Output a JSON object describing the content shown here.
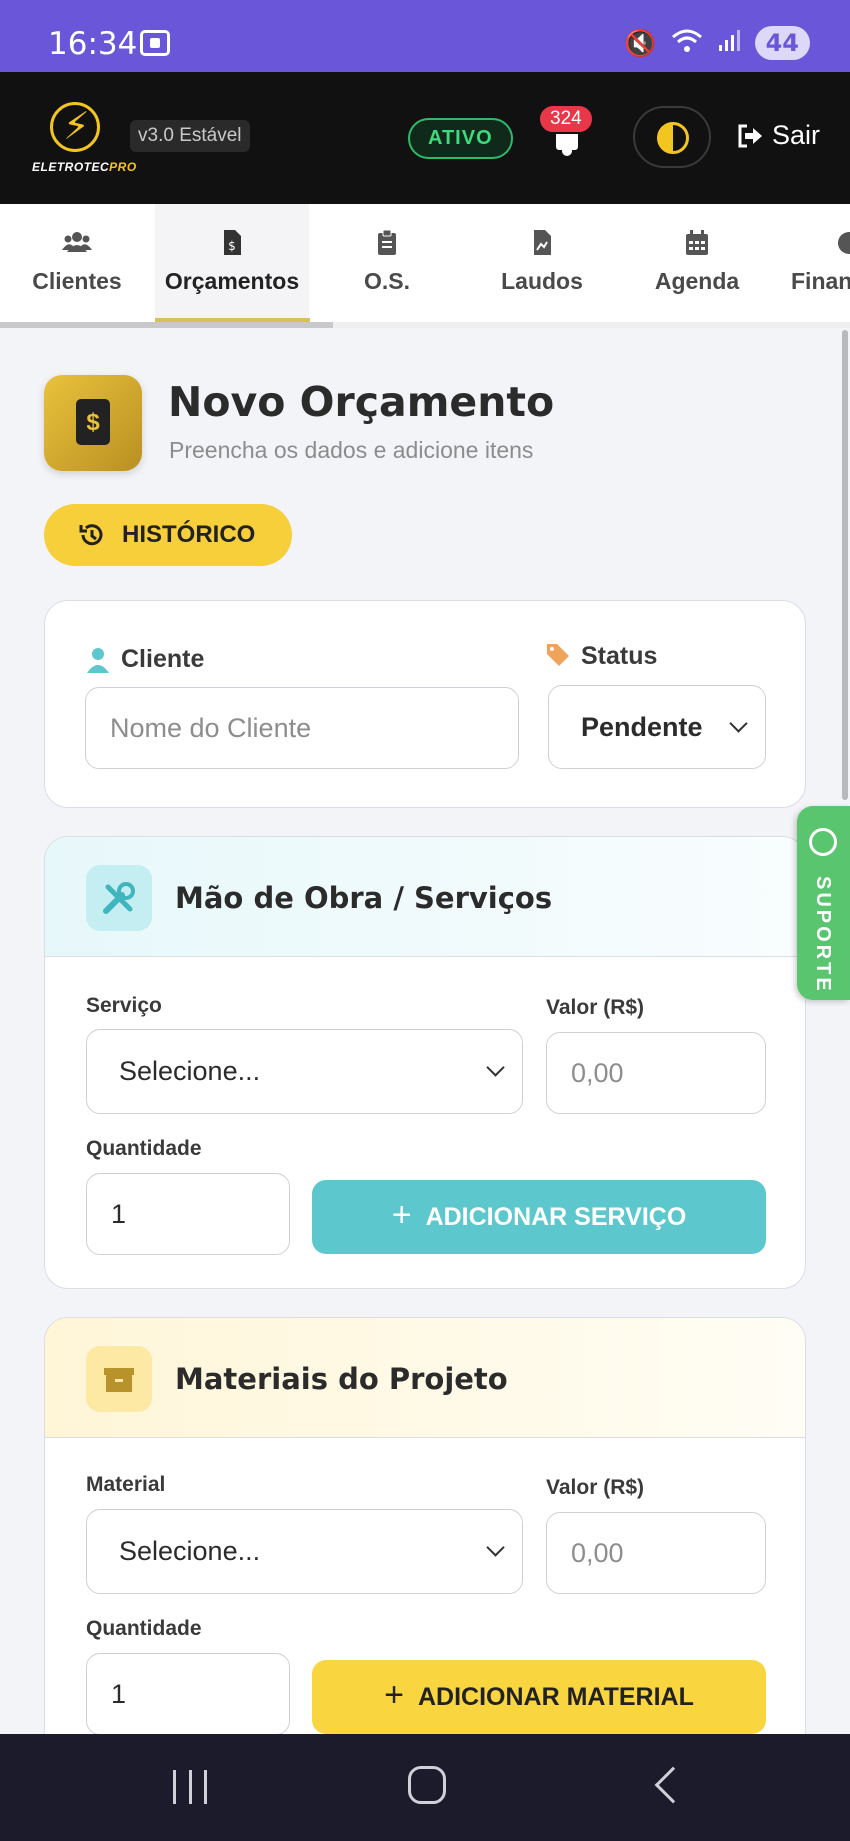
{
  "status_bar": {
    "time": "16:34",
    "battery": "44",
    "icons": [
      "screenshot-icon",
      "mute-icon",
      "wifi-icon",
      "signal-icon"
    ]
  },
  "header": {
    "brand_main": "ELETROTEC",
    "brand_accent": "PRO",
    "version": "v3.0 Estável",
    "status_badge": "ATIVO",
    "notification_count": "324",
    "logout_label": "Sair"
  },
  "tabs": [
    {
      "label": "Clientes",
      "icon": "users-icon"
    },
    {
      "label": "Orçamentos",
      "icon": "invoice-icon",
      "active": true
    },
    {
      "label": "O.S.",
      "icon": "clipboard-icon"
    },
    {
      "label": "Laudos",
      "icon": "report-icon"
    },
    {
      "label": "Agenda",
      "icon": "calendar-icon"
    },
    {
      "label": "Finan",
      "icon": "finance-icon"
    }
  ],
  "page": {
    "title": "Novo Orçamento",
    "subtitle": "Preencha os dados e adicione itens",
    "history_button": "HISTÓRICO"
  },
  "client_card": {
    "client_label": "Cliente",
    "client_placeholder": "Nome do Cliente",
    "status_label": "Status",
    "status_value": "Pendente"
  },
  "services_card": {
    "title": "Mão de Obra / Serviços",
    "service_label": "Serviço",
    "service_value": "Selecione...",
    "value_label": "Valor (R$)",
    "value_placeholder": "0,00",
    "qty_label": "Quantidade",
    "qty_value": "1",
    "add_button": "ADICIONAR SERVIÇO"
  },
  "materials_card": {
    "title": "Materiais do Projeto",
    "material_label": "Material",
    "material_value": "Selecione...",
    "value_label": "Valor (R$)",
    "value_placeholder": "0,00",
    "qty_label": "Quantidade",
    "qty_value": "1",
    "add_button": "ADICIONAR MATERIAL"
  },
  "support_tab": "SUPORTE",
  "colors": {
    "status_bar": "#6a56d8",
    "header": "#111111",
    "accent_yellow": "#f7cf3b",
    "accent_teal": "#5cc8ce",
    "support_green": "#59c56f",
    "badge_red": "#e73748"
  }
}
